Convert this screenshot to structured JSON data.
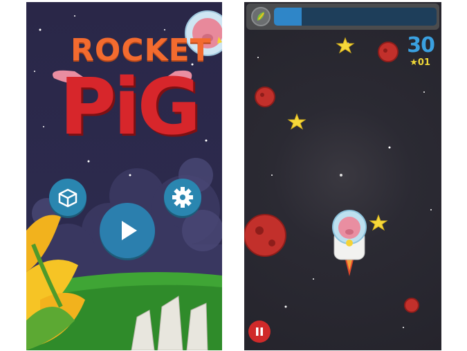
{
  "menu": {
    "title_line1": "ROCKET",
    "title_line2": "PiG",
    "buttons": [
      {
        "name": "shop-box",
        "icon": "box-icon"
      },
      {
        "name": "settings",
        "icon": "gear-icon"
      },
      {
        "name": "play",
        "icon": "play-icon"
      }
    ]
  },
  "game": {
    "score": "30",
    "stars_collected": "★01",
    "progress": 0.17,
    "hud_icon": "leaf-coin-icon",
    "pause_icon": "pause-icon"
  },
  "colors": {
    "sky": "#2c2a4d",
    "button_blue": "#2a86b0",
    "title_orange": "#f36b2f",
    "title_red": "#d7262b",
    "score_blue": "#3aa0e0",
    "star_yellow": "#f0d838",
    "asteroid_red": "#c2302b",
    "grass_green": "#3fa535",
    "pause_red": "#d02a2a"
  }
}
